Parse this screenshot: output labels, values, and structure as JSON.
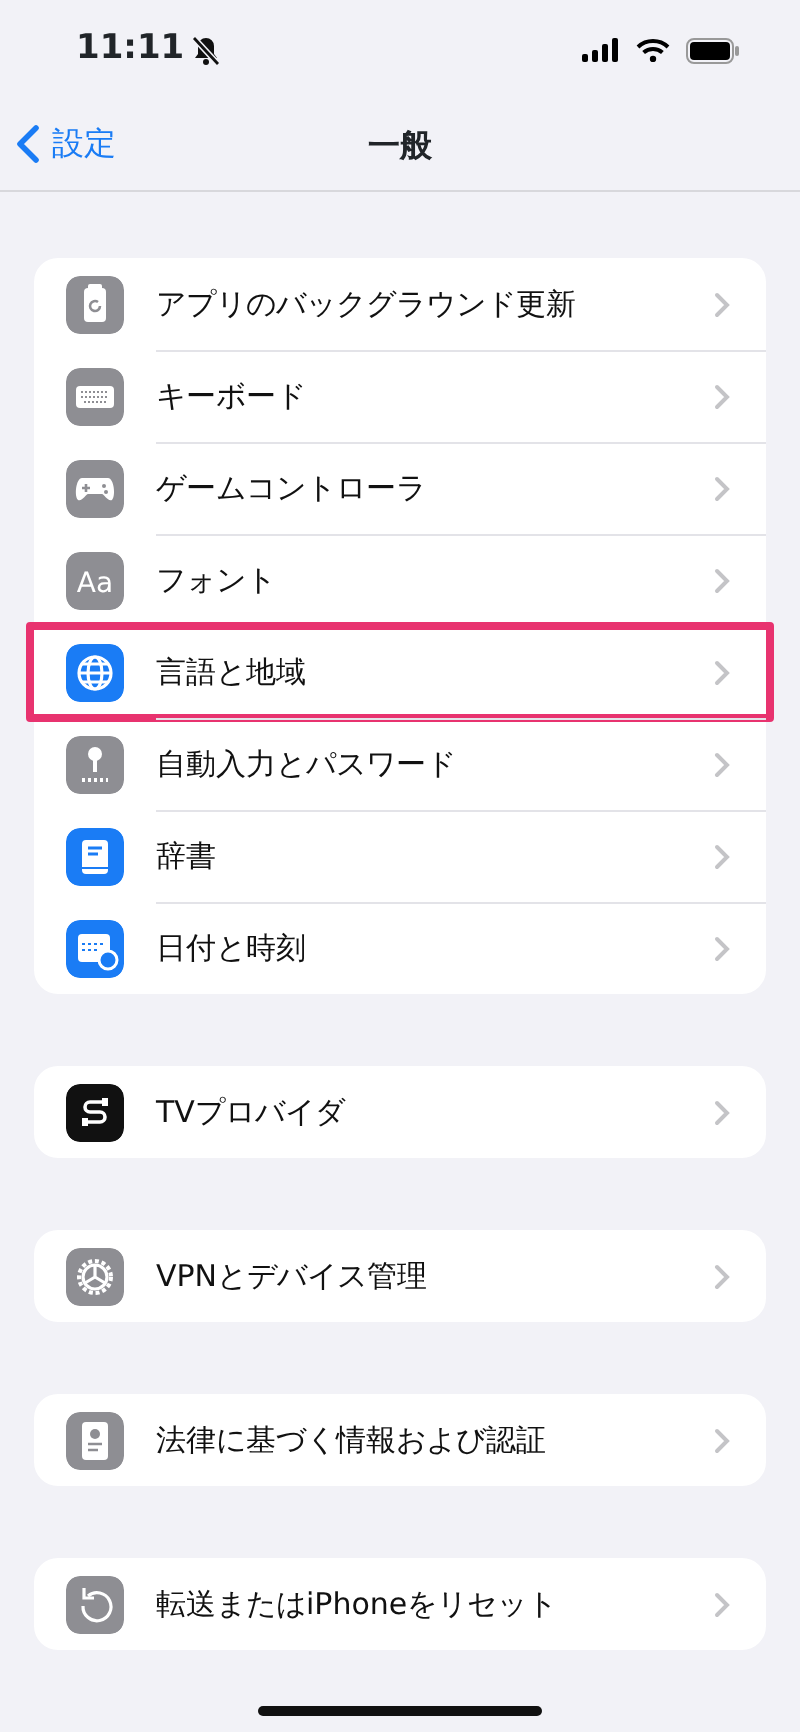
{
  "status_bar": {
    "time": "11:11",
    "silent": true
  },
  "nav": {
    "back": "設定",
    "title": "一般"
  },
  "groups": [
    {
      "items": [
        {
          "label": "アプリのバックグラウンド更新",
          "kind": "refresh",
          "color": "#8e8e93",
          "highlighted": false
        },
        {
          "label": "キーボード",
          "kind": "keyboard",
          "color": "#8e8e93",
          "highlighted": false
        },
        {
          "label": "ゲームコントローラ",
          "kind": "gamepad",
          "color": "#8e8e93",
          "highlighted": false
        },
        {
          "label": "フォント",
          "kind": "font",
          "icon_text": "Aa",
          "color": "#8e8e93",
          "highlighted": false
        },
        {
          "label": "言語と地域",
          "kind": "globe",
          "color": "#1a7cf5",
          "highlighted": true
        },
        {
          "label": "自動入力とパスワード",
          "kind": "key",
          "color": "#8e8e93",
          "highlighted": false
        },
        {
          "label": "辞書",
          "kind": "book",
          "color": "#1a7cf5",
          "highlighted": false
        },
        {
          "label": "日付と時刻",
          "kind": "calendar",
          "color": "#1a7cf5",
          "highlighted": false
        }
      ]
    },
    {
      "items": [
        {
          "label": "TVプロバイダ",
          "kind": "cable",
          "color": "#111111",
          "highlighted": false
        }
      ]
    },
    {
      "items": [
        {
          "label": "VPNとデバイス管理",
          "kind": "gear",
          "color": "#8e8e93",
          "highlighted": false
        }
      ]
    },
    {
      "items": [
        {
          "label": "法律に基づく情報および認証",
          "kind": "certificate",
          "color": "#8e8e93",
          "highlighted": false
        }
      ]
    },
    {
      "items": [
        {
          "label": "転送またはiPhoneをリセット",
          "kind": "reset",
          "color": "#8e8e93",
          "highlighted": false
        }
      ]
    }
  ]
}
